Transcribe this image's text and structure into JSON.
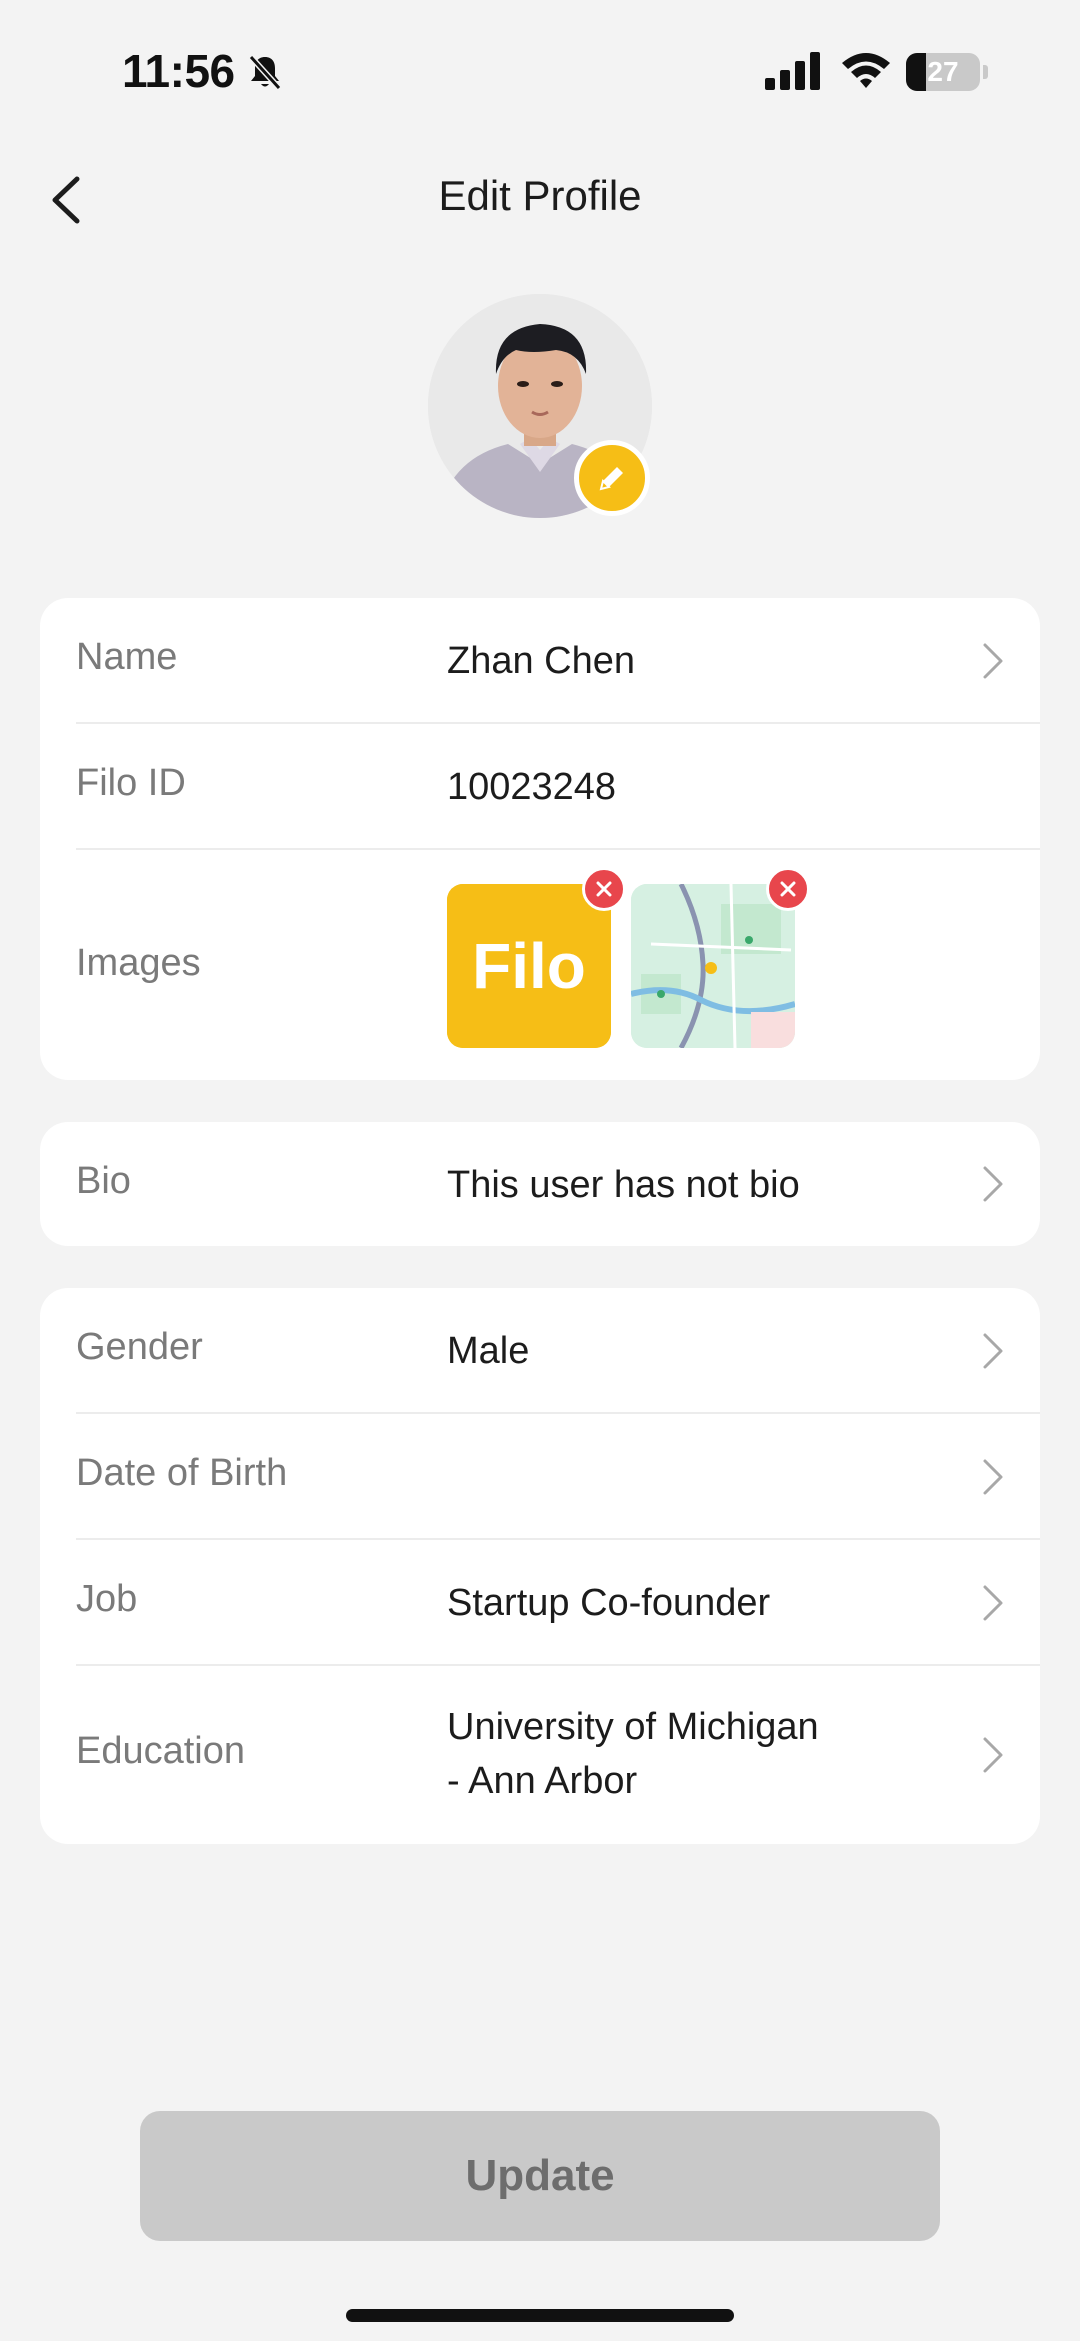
{
  "status_bar": {
    "time": "11:56",
    "battery": "27",
    "battery_level": 0.27
  },
  "header": {
    "title": "Edit Profile"
  },
  "profile_info": {
    "name_label": "Name",
    "name_value": "Zhan Chen",
    "filo_id_label": "Filo ID",
    "filo_id_value": "10023248",
    "images_label": "Images",
    "logo_image_text": "Filo"
  },
  "bio": {
    "label": "Bio",
    "value": "This user has not bio"
  },
  "details": {
    "gender_label": "Gender",
    "gender_value": "Male",
    "dob_label": "Date of Birth",
    "dob_value": "",
    "job_label": "Job",
    "job_value": "Startup Co-founder",
    "education_label": "Education",
    "education_line1": "University of Michigan",
    "education_line2": "- Ann Arbor"
  },
  "update_button_label": "Update",
  "colors": {
    "accent": "#f6be16",
    "remove": "#e8464c",
    "disabled_button": "#c9c9c9",
    "background": "#f3f3f3"
  }
}
